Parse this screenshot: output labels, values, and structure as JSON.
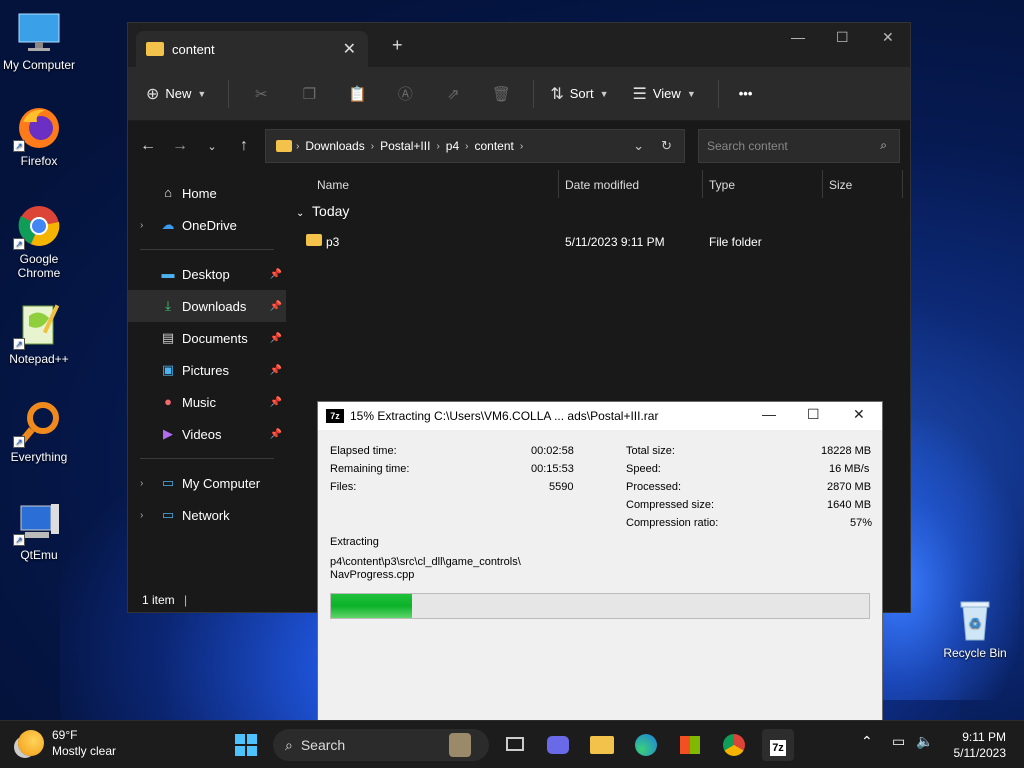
{
  "desktop": {
    "icons": [
      {
        "label": "My Computer",
        "icon": "monitor-icon"
      },
      {
        "label": "Firefox",
        "icon": "firefox-icon"
      },
      {
        "label": "Google Chrome",
        "icon": "chrome-icon"
      },
      {
        "label": "Notepad++",
        "icon": "notepadpp-icon"
      },
      {
        "label": "Everything",
        "icon": "everything-icon"
      },
      {
        "label": "QtEmu",
        "icon": "qtemu-icon"
      }
    ],
    "recycle_bin": "Recycle Bin"
  },
  "explorer": {
    "tab_title": "content",
    "toolbar": {
      "new_label": "New",
      "sort_label": "Sort",
      "view_label": "View",
      "more_label": "•••"
    },
    "breadcrumb": [
      "Downloads",
      "Postal+III",
      "p4",
      "content"
    ],
    "search_placeholder": "Search content",
    "nav": {
      "home": "Home",
      "onedrive": "OneDrive",
      "desktop": "Desktop",
      "downloads": "Downloads",
      "documents": "Documents",
      "pictures": "Pictures",
      "music": "Music",
      "videos": "Videos",
      "my_computer": "My Computer",
      "network": "Network"
    },
    "columns": {
      "name": "Name",
      "date": "Date modified",
      "type": "Type",
      "size": "Size"
    },
    "group_label": "Today",
    "files": [
      {
        "name": "p3",
        "date": "5/11/2023 9:11 PM",
        "type": "File folder",
        "size": ""
      }
    ],
    "status": "1 item"
  },
  "zip_dialog": {
    "title": "15% Extracting C:\\Users\\VM6.COLLA ... ads\\Postal+III.rar",
    "logo_text": "7z",
    "left": {
      "elapsed_label": "Elapsed time:",
      "elapsed_value": "00:02:58",
      "remaining_label": "Remaining time:",
      "remaining_value": "00:15:53",
      "files_label": "Files:",
      "files_value": "5590"
    },
    "right": {
      "total_label": "Total size:",
      "total_value": "18228 MB",
      "speed_label": "Speed:",
      "speed_value": "16 MB/s",
      "processed_label": "Processed:",
      "processed_value": "2870 MB",
      "compressed_label": "Compressed size:",
      "compressed_value": "1640 MB",
      "ratio_label": "Compression ratio:",
      "ratio_value": "57%"
    },
    "extracting_label": "Extracting",
    "current_path": "p4\\content\\p3\\src\\cl_dll\\game_controls\\",
    "current_file": "NavProgress.cpp",
    "progress_fraction": 0.15
  },
  "taskbar": {
    "weather_temp": "69°F",
    "weather_desc": "Mostly clear",
    "search_label": "Search",
    "time": "9:11 PM",
    "date": "5/11/2023"
  }
}
